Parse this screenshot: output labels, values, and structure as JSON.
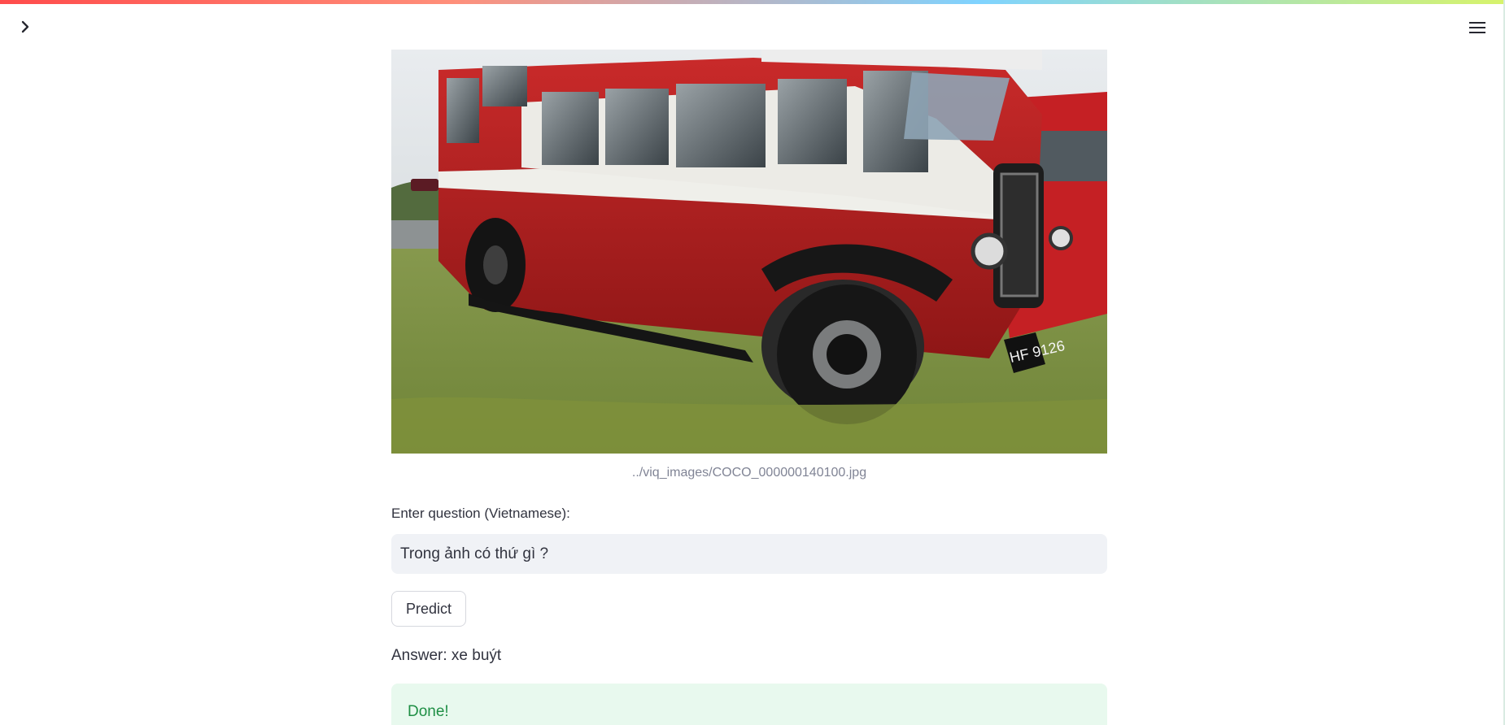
{
  "app": {
    "accent_colors": {
      "top_bar_start": "#ff4b4b",
      "top_bar_end": "#d7f36b",
      "success_background": "#e8f9ee",
      "success_text": "#1f8f45"
    },
    "sidebar_toggle_icon": "chevron-right-icon",
    "menu_icon": "hamburger-menu-icon"
  },
  "image": {
    "caption": "../viq_images/COCO_000000140100.jpg",
    "visible_plate": "HF 9126"
  },
  "question": {
    "label": "Enter question (Vietnamese):",
    "value": "Trong ảnh có thứ gì ?"
  },
  "actions": {
    "predict_label": "Predict"
  },
  "result": {
    "answer": "Answer: xe buýt",
    "status": "Done!"
  }
}
